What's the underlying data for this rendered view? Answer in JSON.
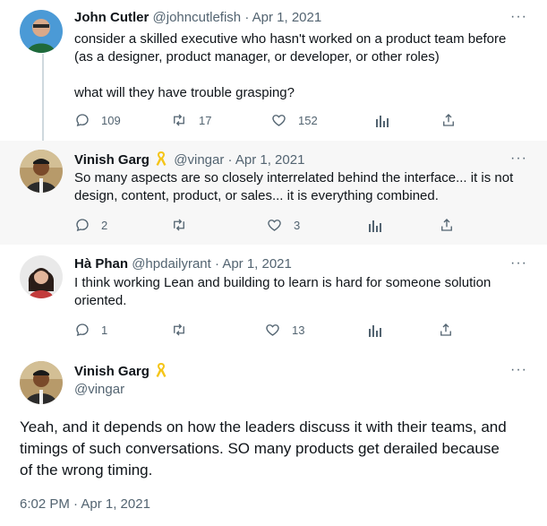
{
  "tweets": [
    {
      "name": "John Cutler",
      "handle": "@johncutlefish",
      "date": "Apr 1, 2021",
      "text_line1": "consider a skilled executive who hasn't worked on a product team before",
      "text_line2": "(as a designer, product manager, or developer, or other roles)",
      "text_line3": "what will they have trouble grasping?",
      "replies": "109",
      "retweets": "17",
      "likes": "152"
    },
    {
      "name": "Vinish Garg",
      "handle": "@vingar",
      "date": "Apr 1, 2021",
      "text_line1": "So many aspects are so closely interrelated behind the interface... it is not",
      "text_line2": "design, content, product, or sales... it is everything combined.",
      "replies": "2",
      "retweets": "",
      "likes": "3"
    },
    {
      "name": "Hà Phan",
      "handle": "@hpdailyrant",
      "date": "Apr 1, 2021",
      "text_line1": "I think working Lean and building to learn is hard for someone solution",
      "text_line2": "oriented.",
      "replies": "1",
      "retweets": "",
      "likes": "13"
    }
  ],
  "main_tweet": {
    "name": "Vinish Garg",
    "handle": "@vingar",
    "text_line1": "Yeah, and it depends on how the leaders discuss it with their teams, and",
    "text_line2": "timings of such conversations. SO many products get derailed because",
    "text_line3": "of the wrong timing.",
    "timestamp": "6:02 PM · Apr 1, 2021"
  },
  "more_glyph": "···",
  "separator": "·",
  "colors": {
    "badge": "#f5c518",
    "muted": "#536471",
    "line": "#cfd9de"
  }
}
